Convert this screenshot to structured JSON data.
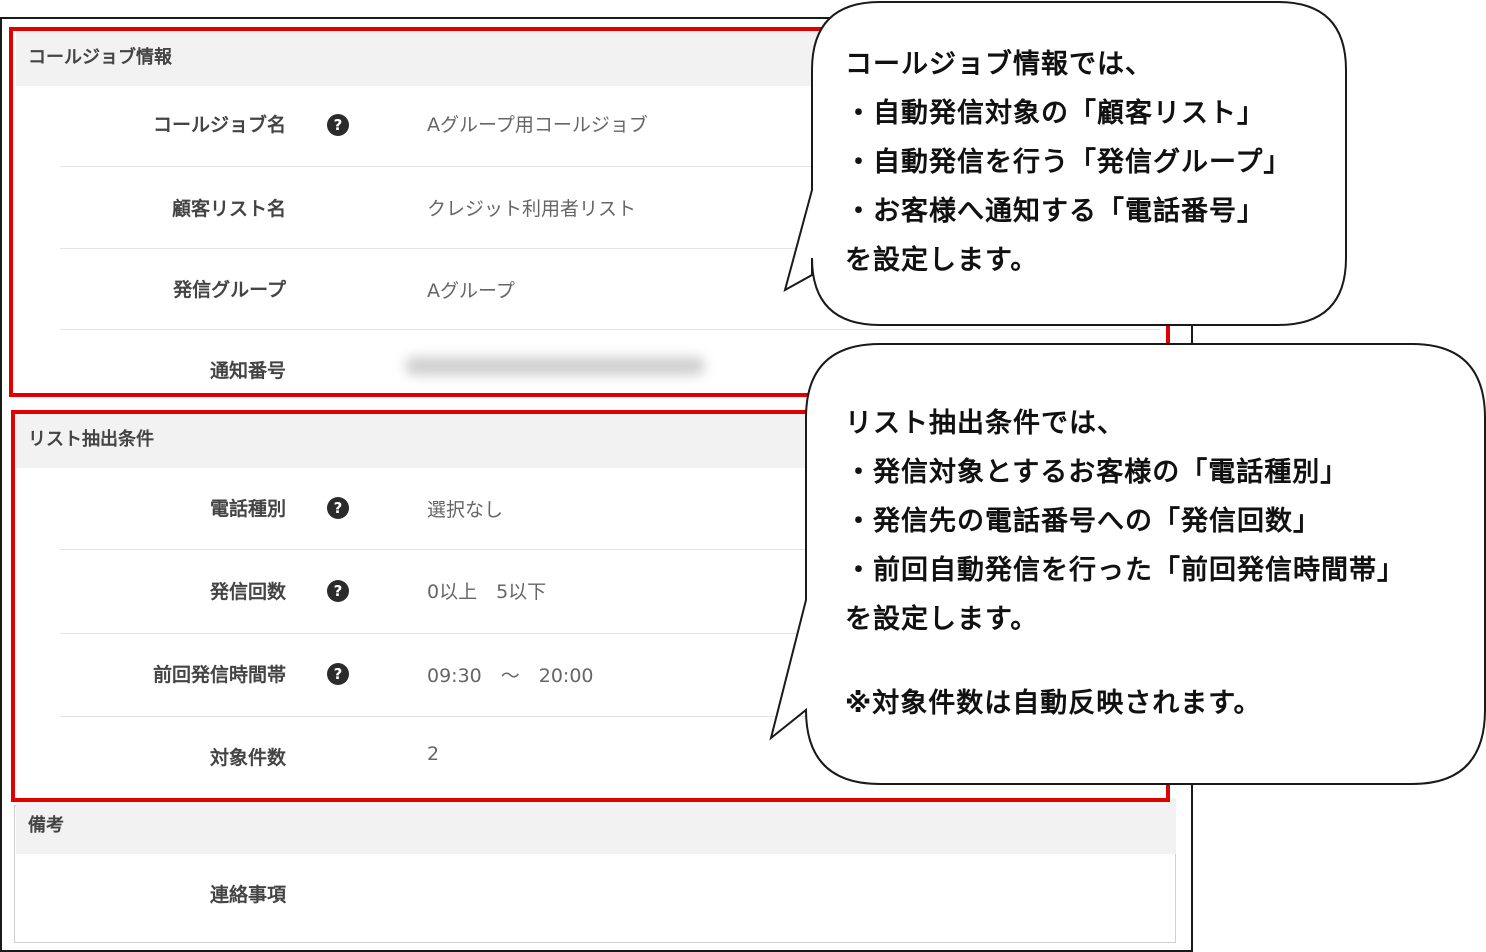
{
  "call_job_info": {
    "header": "コールジョブ情報",
    "rows": [
      {
        "label": "コールジョブ名",
        "value": "Aグループ用コールジョブ",
        "help": "?"
      },
      {
        "label": "顧客リスト名",
        "value": "クレジット利用者リスト"
      },
      {
        "label": "発信グループ",
        "value": "Aグループ"
      },
      {
        "label": "通知番号",
        "value": ""
      }
    ]
  },
  "list_conditions": {
    "header": "リスト抽出条件",
    "rows": [
      {
        "label": "電話種別",
        "value": "選択なし",
        "help": "?"
      },
      {
        "label": "発信回数",
        "value": "0以上　5以下",
        "help": "?"
      },
      {
        "label": "前回発信時間帯",
        "value": "09:30　～　20:00",
        "help": "?"
      },
      {
        "label": "対象件数",
        "value": "2"
      }
    ]
  },
  "notes": {
    "header": "備考",
    "rows": [
      {
        "label": "連絡事項",
        "value": ""
      }
    ]
  },
  "callout1": {
    "lines": [
      "コールジョブ情報では、",
      "・自動発信対象の「顧客リスト」",
      "・自動発信を行う「発信グループ」",
      "・お客様へ通知する「電話番号」",
      "を設定します。"
    ]
  },
  "callout2": {
    "lines": [
      "リスト抽出条件では、",
      "・発信対象とするお客様の「電話種別」",
      "・発信先の電話番号への「発信回数」",
      "・前回自動発信を行った「前回発信時間帯」",
      "を設定します。",
      "",
      "※対象件数は自動反映されます。"
    ]
  },
  "colors": {
    "highlight": "#e00000",
    "header_bg": "#f2f2f2"
  }
}
